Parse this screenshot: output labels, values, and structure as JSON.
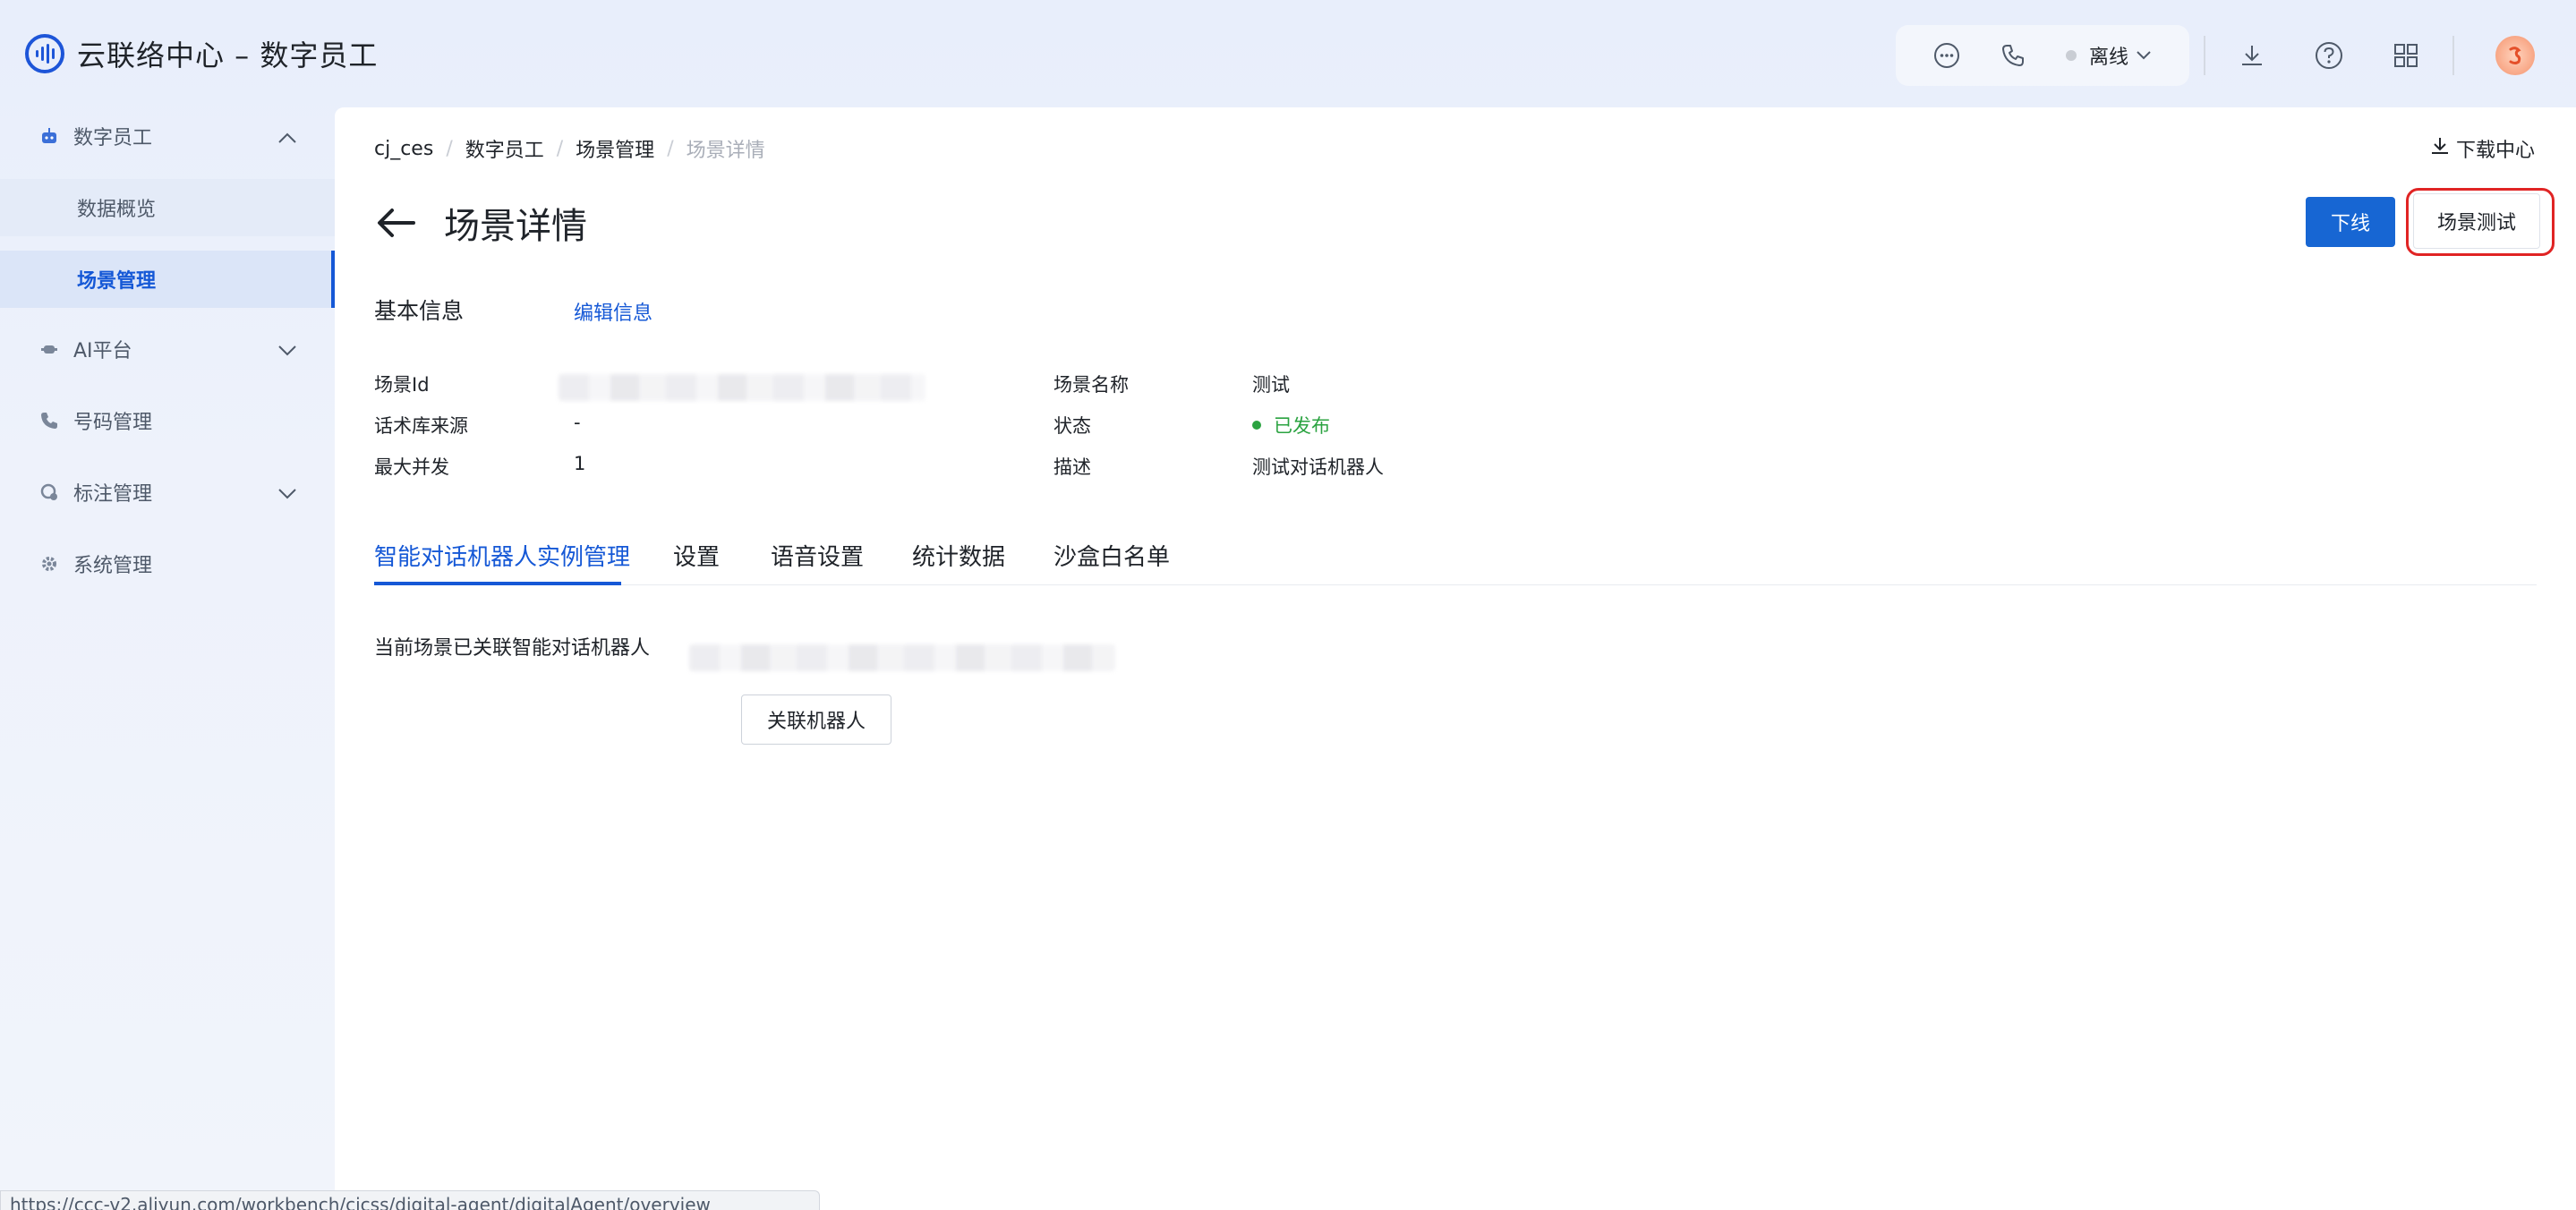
{
  "header": {
    "title": "云联络中心 – 数字员工",
    "status": "离线"
  },
  "sidebar": {
    "digital_employee": "数字员工",
    "sub_overview": "数据概览",
    "sub_scene": "场景管理",
    "ai_platform": "AI平台",
    "number_mgmt": "号码管理",
    "annotation_mgmt": "标注管理",
    "system_mgmt": "系统管理"
  },
  "breadcrumb": {
    "items": [
      "cj_ces",
      "数字员工",
      "场景管理",
      "场景详情"
    ],
    "sep": "/"
  },
  "download_center": "下载中心",
  "page": {
    "title": "场景详情",
    "offline_btn": "下线",
    "test_btn": "场景测试"
  },
  "basic_info": {
    "label": "基本信息",
    "edit": "编辑信息",
    "fields": {
      "scene_id_label": "场景Id",
      "source_label": "话术库来源",
      "source_value": "-",
      "concurrency_label": "最大并发",
      "concurrency_value": "1",
      "name_label": "场景名称",
      "name_value": "测试",
      "status_label": "状态",
      "status_value": "已发布",
      "desc_label": "描述",
      "desc_value": "测试对话机器人"
    }
  },
  "tabs": [
    "智能对话机器人实例管理",
    "设置",
    "语音设置",
    "统计数据",
    "沙盒白名单"
  ],
  "bot_section": {
    "label": "当前场景已关联智能对话机器人",
    "link_button": "关联机器人"
  },
  "url_hint": "https://ccc-v2.aliyun.com/workbench/cicss/digital-agent/digitalAgent/overview",
  "colors": {
    "primary": "#1766d3",
    "active_link": "#1558d6",
    "published": "#2ba341",
    "highlight": "#e02424"
  }
}
